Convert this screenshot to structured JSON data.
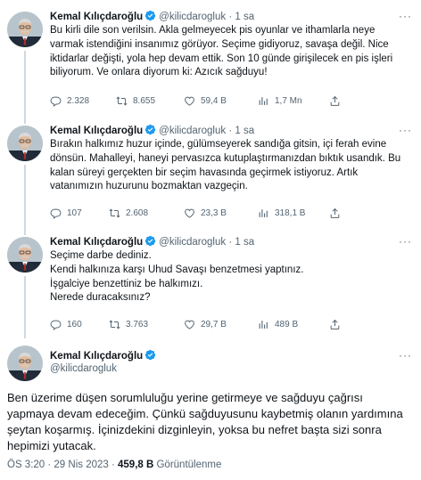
{
  "author": {
    "name": "Kemal Kılıçdaroğlu",
    "handle": "@kilicdarogluk"
  },
  "colors": {
    "verified": "#1d9bf0",
    "muted": "#536471",
    "text": "#0f1419",
    "line": "#cfd9de"
  },
  "tweets": [
    {
      "time": "1 sa",
      "text": "Bu kirli dile son verilsin. Akla gelmeyecek pis oyunlar ve ithamlarla neye varmak istendiğini insanımız görüyor. Seçime gidiyoruz, savaşa değil. Nice iktidarlar değişti, yola hep devam ettik. Son 10 günde girişilecek en pis işleri biliyorum. Ve onlara diyorum ki: Azıcık sağduyu!",
      "replies": "2.328",
      "retweets": "8.655",
      "likes": "59,4 B",
      "views": "1,7 Mn"
    },
    {
      "time": "1 sa",
      "text": "Bırakın halkımız huzur içinde, gülümseyerek sandığa gitsin, içi ferah evine dönsün. Mahalleyi, haneyi pervasızca kutuplaştırmanızdan bıktık usandık. Bu kalan süreyi gerçekten bir seçim havasında geçirmek istiyoruz. Artık vatanımızın huzurunu bozmaktan vazgeçin.",
      "replies": "107",
      "retweets": "2.608",
      "likes": "23,3 B",
      "views": "318,1 B"
    },
    {
      "time": "1 sa",
      "text": "Seçime darbe dediniz.\nKendi halkınıza karşı Uhud Savaşı benzetmesi yaptınız.\nİşgalciye benzettiniz be halkımızı.\nNerede duracaksınız?",
      "replies": "160",
      "retweets": "3.763",
      "likes": "29,7 B",
      "views": "489 B"
    }
  ],
  "main_tweet": {
    "text": "Ben üzerime düşen sorumluluğu yerine getirmeye ve sağduyu çağrısı yapmaya devam edeceğim. Çünkü sağduyusunu kaybetmiş olanın yardımına şeytan koşarmış. İçinizdekini dizginleyin, yoksa bu nefret başta sizi sonra hepimizi yutacak.",
    "timestamp": "ÖS 3:20 · 29 Nis 2023 · ",
    "views_count": "459,8 B",
    "views_label": " Görüntülenme"
  },
  "icons": {
    "verified": "verified-badge-icon",
    "more": "more-options-icon",
    "reply": "reply-icon",
    "retweet": "retweet-icon",
    "like": "heart-icon",
    "views": "views-chart-icon",
    "share": "share-icon"
  }
}
